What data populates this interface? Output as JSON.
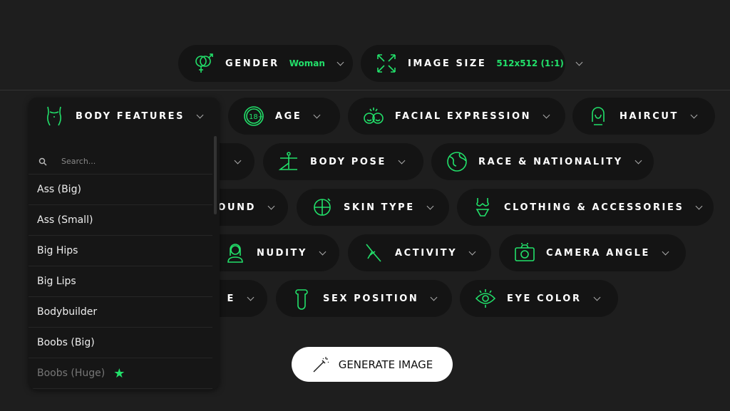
{
  "accent": "#22e06a",
  "top": [
    {
      "label": "GENDER",
      "value": "Woman",
      "icon": "gender-icon"
    },
    {
      "label": "IMAGE SIZE",
      "value": "512x512 (1:1)",
      "icon": "expand-icon"
    }
  ],
  "pills": [
    {
      "label": "AGE",
      "icon": "age-18-icon"
    },
    {
      "label": "FACIAL EXPRESSION",
      "icon": "faces-icon"
    },
    {
      "label": "HAIRCUT",
      "icon": "haircut-icon"
    },
    {
      "label": "",
      "icon": ""
    },
    {
      "label": "BODY POSE",
      "icon": "yoga-pose-icon"
    },
    {
      "label": "RACE & NATIONALITY",
      "icon": "globe-icon"
    },
    {
      "label": "OUND",
      "icon": ""
    },
    {
      "label": "SKIN TYPE",
      "icon": "skin-face-icon"
    },
    {
      "label": "CLOTHING & ACCESSORIES",
      "icon": "bikini-icon"
    },
    {
      "label": "NUDITY",
      "icon": "woman-icon"
    },
    {
      "label": "ACTIVITY",
      "icon": "activity-icon"
    },
    {
      "label": "CAMERA ANGLE",
      "icon": "camera-icon"
    },
    {
      "label": "E",
      "icon": ""
    },
    {
      "label": "SEX POSITION",
      "icon": "position-icon"
    },
    {
      "label": "EYE COLOR",
      "icon": "eye-icon"
    }
  ],
  "dropdown": {
    "label": "BODY FEATURES",
    "icon": "body-icon",
    "search_placeholder": "Search...",
    "items": [
      "Ass (Big)",
      "Ass (Small)",
      "Big Hips",
      "Big Lips",
      "Bodybuilder",
      "Boobs (Big)",
      "Boobs (Huge)"
    ]
  },
  "generate": {
    "label": "GENERATE IMAGE",
    "icon": "magic-wand-icon"
  }
}
